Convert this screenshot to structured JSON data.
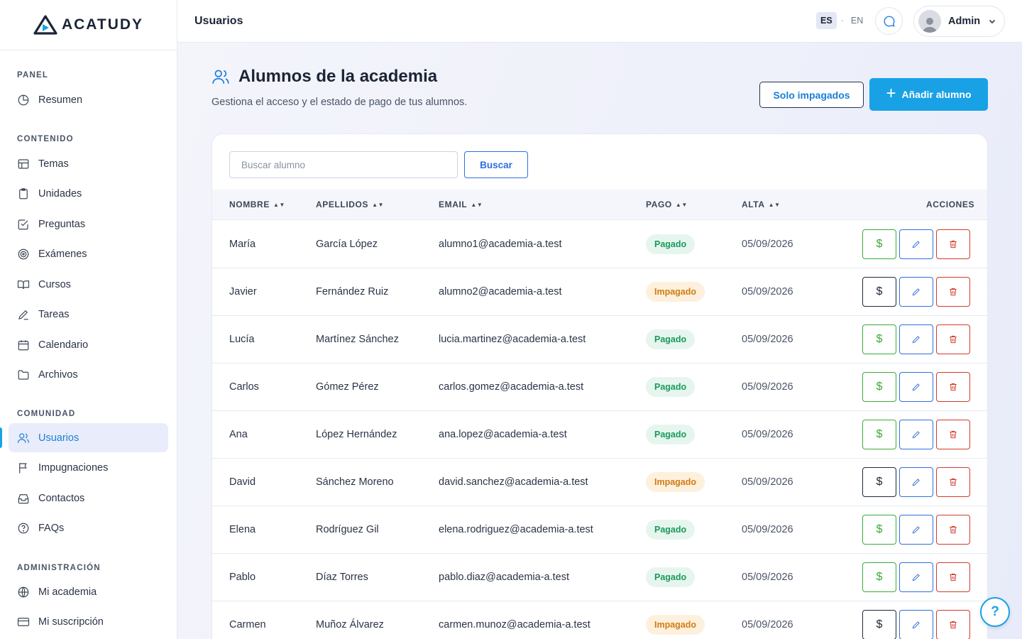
{
  "app": {
    "logo_text": "ACATUDY"
  },
  "topbar": {
    "title": "Usuarios",
    "lang_es": "ES",
    "lang_sep": "·",
    "lang_en": "EN",
    "user_name": "Admin"
  },
  "sidebar": {
    "sections": [
      {
        "heading": "PANEL",
        "items": [
          {
            "label": "Resumen",
            "icon": "pie-chart-icon"
          }
        ]
      },
      {
        "heading": "CONTENIDO",
        "items": [
          {
            "label": "Temas",
            "icon": "layout-icon"
          },
          {
            "label": "Unidades",
            "icon": "clipboard-icon"
          },
          {
            "label": "Preguntas",
            "icon": "check-square-icon"
          },
          {
            "label": "Exámenes",
            "icon": "target-icon"
          },
          {
            "label": "Cursos",
            "icon": "book-open-icon"
          },
          {
            "label": "Tareas",
            "icon": "pen-icon"
          },
          {
            "label": "Calendario",
            "icon": "calendar-icon"
          },
          {
            "label": "Archivos",
            "icon": "folder-icon"
          }
        ]
      },
      {
        "heading": "COMUNIDAD",
        "items": [
          {
            "label": "Usuarios",
            "icon": "users-icon",
            "active": true
          },
          {
            "label": "Impugnaciones",
            "icon": "flag-icon"
          },
          {
            "label": "Contactos",
            "icon": "inbox-icon"
          },
          {
            "label": "FAQs",
            "icon": "help-circle-icon"
          }
        ]
      },
      {
        "heading": "ADMINISTRACIÓN",
        "items": [
          {
            "label": "Mi academia",
            "icon": "globe-icon"
          },
          {
            "label": "Mi suscripción",
            "icon": "credit-card-icon"
          }
        ]
      }
    ]
  },
  "page": {
    "title": "Alumnos de la academia",
    "subtitle": "Gestiona el acceso y el estado de pago de tus alumnos.",
    "btn_unpaid": "Solo impagados",
    "btn_add": "Añadir alumno"
  },
  "search": {
    "placeholder": "Buscar alumno",
    "button": "Buscar"
  },
  "table": {
    "headers": {
      "nombre": "NOMBRE",
      "apellidos": "APELLIDOS",
      "email": "EMAIL",
      "pago": "PAGO",
      "alta": "ALTA",
      "acciones": "ACCIONES"
    },
    "action_pay_symbol": "$",
    "rows": [
      {
        "nombre": "María",
        "apellidos": "García López",
        "email": "alumno1@academia-a.test",
        "pago": "Pagado",
        "paid": true,
        "alta": "05/09/2026"
      },
      {
        "nombre": "Javier",
        "apellidos": "Fernández Ruiz",
        "email": "alumno2@academia-a.test",
        "pago": "Impagado",
        "paid": false,
        "alta": "05/09/2026"
      },
      {
        "nombre": "Lucía",
        "apellidos": "Martínez Sánchez",
        "email": "lucia.martinez@academia-a.test",
        "pago": "Pagado",
        "paid": true,
        "alta": "05/09/2026"
      },
      {
        "nombre": "Carlos",
        "apellidos": "Gómez Pérez",
        "email": "carlos.gomez@academia-a.test",
        "pago": "Pagado",
        "paid": true,
        "alta": "05/09/2026"
      },
      {
        "nombre": "Ana",
        "apellidos": "López Hernández",
        "email": "ana.lopez@academia-a.test",
        "pago": "Pagado",
        "paid": true,
        "alta": "05/09/2026"
      },
      {
        "nombre": "David",
        "apellidos": "Sánchez Moreno",
        "email": "david.sanchez@academia-a.test",
        "pago": "Impagado",
        "paid": false,
        "alta": "05/09/2026"
      },
      {
        "nombre": "Elena",
        "apellidos": "Rodríguez Gil",
        "email": "elena.rodriguez@academia-a.test",
        "pago": "Pagado",
        "paid": true,
        "alta": "05/09/2026"
      },
      {
        "nombre": "Pablo",
        "apellidos": "Díaz Torres",
        "email": "pablo.diaz@academia-a.test",
        "pago": "Pagado",
        "paid": true,
        "alta": "05/09/2026"
      },
      {
        "nombre": "Carmen",
        "apellidos": "Muñoz Álvarez",
        "email": "carmen.munoz@academia-a.test",
        "pago": "Impagado",
        "paid": false,
        "alta": "05/09/2026"
      }
    ]
  },
  "help": {
    "label": "?"
  },
  "colors": {
    "accent": "#19a1e6",
    "link": "#1a7fd8",
    "paid": "#3aab3a",
    "delete": "#d33a2c",
    "edit": "#2f6fe0"
  }
}
